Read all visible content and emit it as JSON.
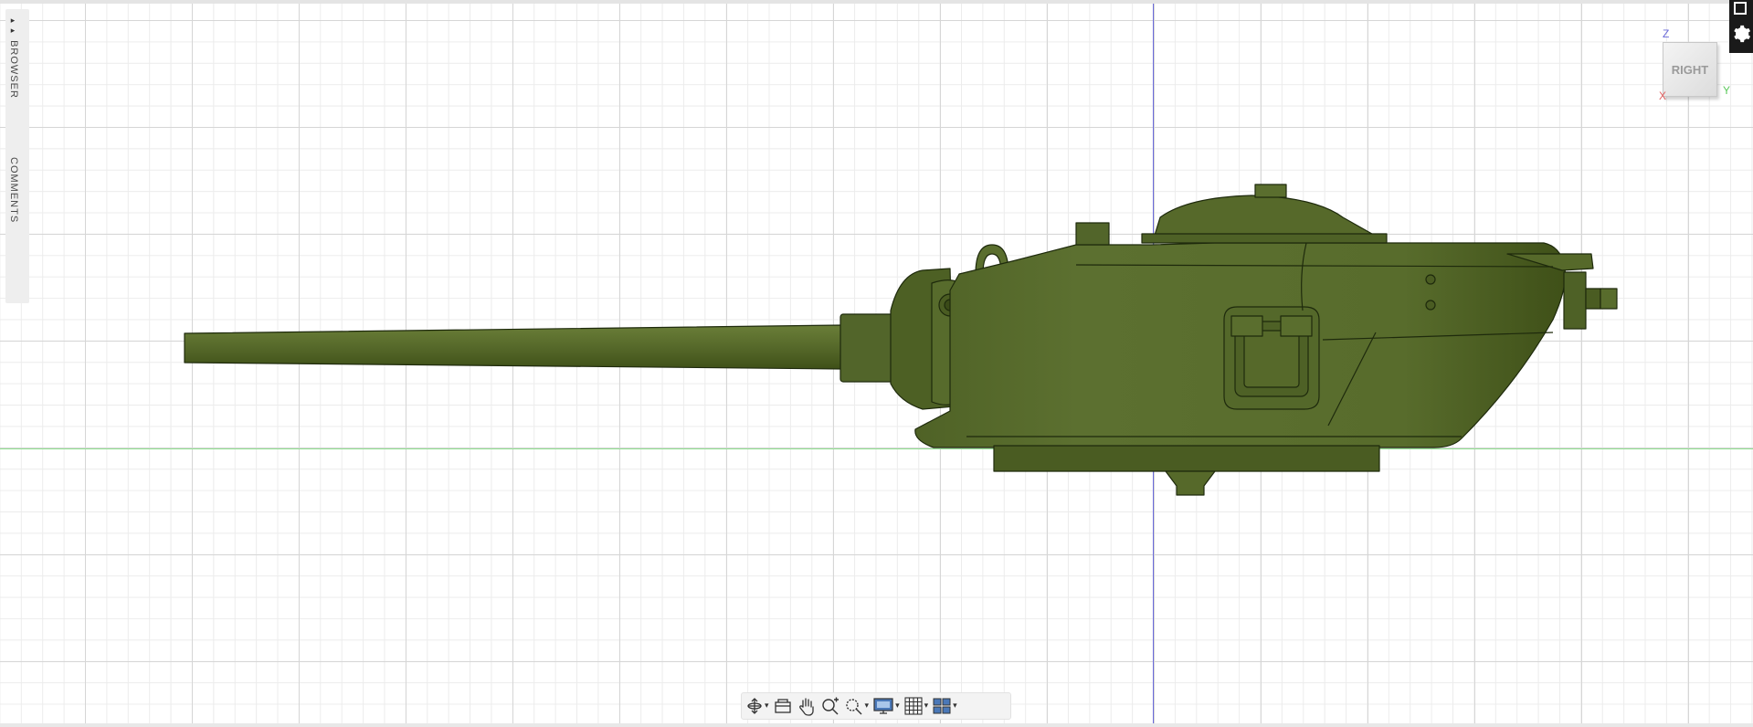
{
  "panel": {
    "browser_label": "BROWSER",
    "browser_arrow": "▸▸",
    "comments_label": "COMMENTS"
  },
  "viewcube": {
    "face_label": "RIGHT",
    "axis_z": "Z",
    "axis_x": "X",
    "axis_y": "Y"
  },
  "colors": {
    "model_fill": "#5a6e2e",
    "model_outline": "#1e2a0c",
    "axis_z": "#6b6bdc",
    "axis_y": "#8fe08f",
    "grid_major": "#d6d6d6",
    "grid_minor": "#ececec"
  },
  "toolbar": {
    "buttons": [
      {
        "name": "orbit-icon",
        "caret": "▾"
      },
      {
        "name": "look-at-icon",
        "caret": ""
      },
      {
        "name": "pan-icon",
        "caret": ""
      },
      {
        "name": "zoom-icon",
        "caret": ""
      },
      {
        "name": "zoom-window-icon",
        "caret": "▾"
      },
      {
        "name": "display-settings-icon",
        "caret": "▾"
      },
      {
        "name": "grid-settings-icon",
        "caret": "▾"
      },
      {
        "name": "viewports-icon",
        "caret": "▾"
      }
    ]
  }
}
